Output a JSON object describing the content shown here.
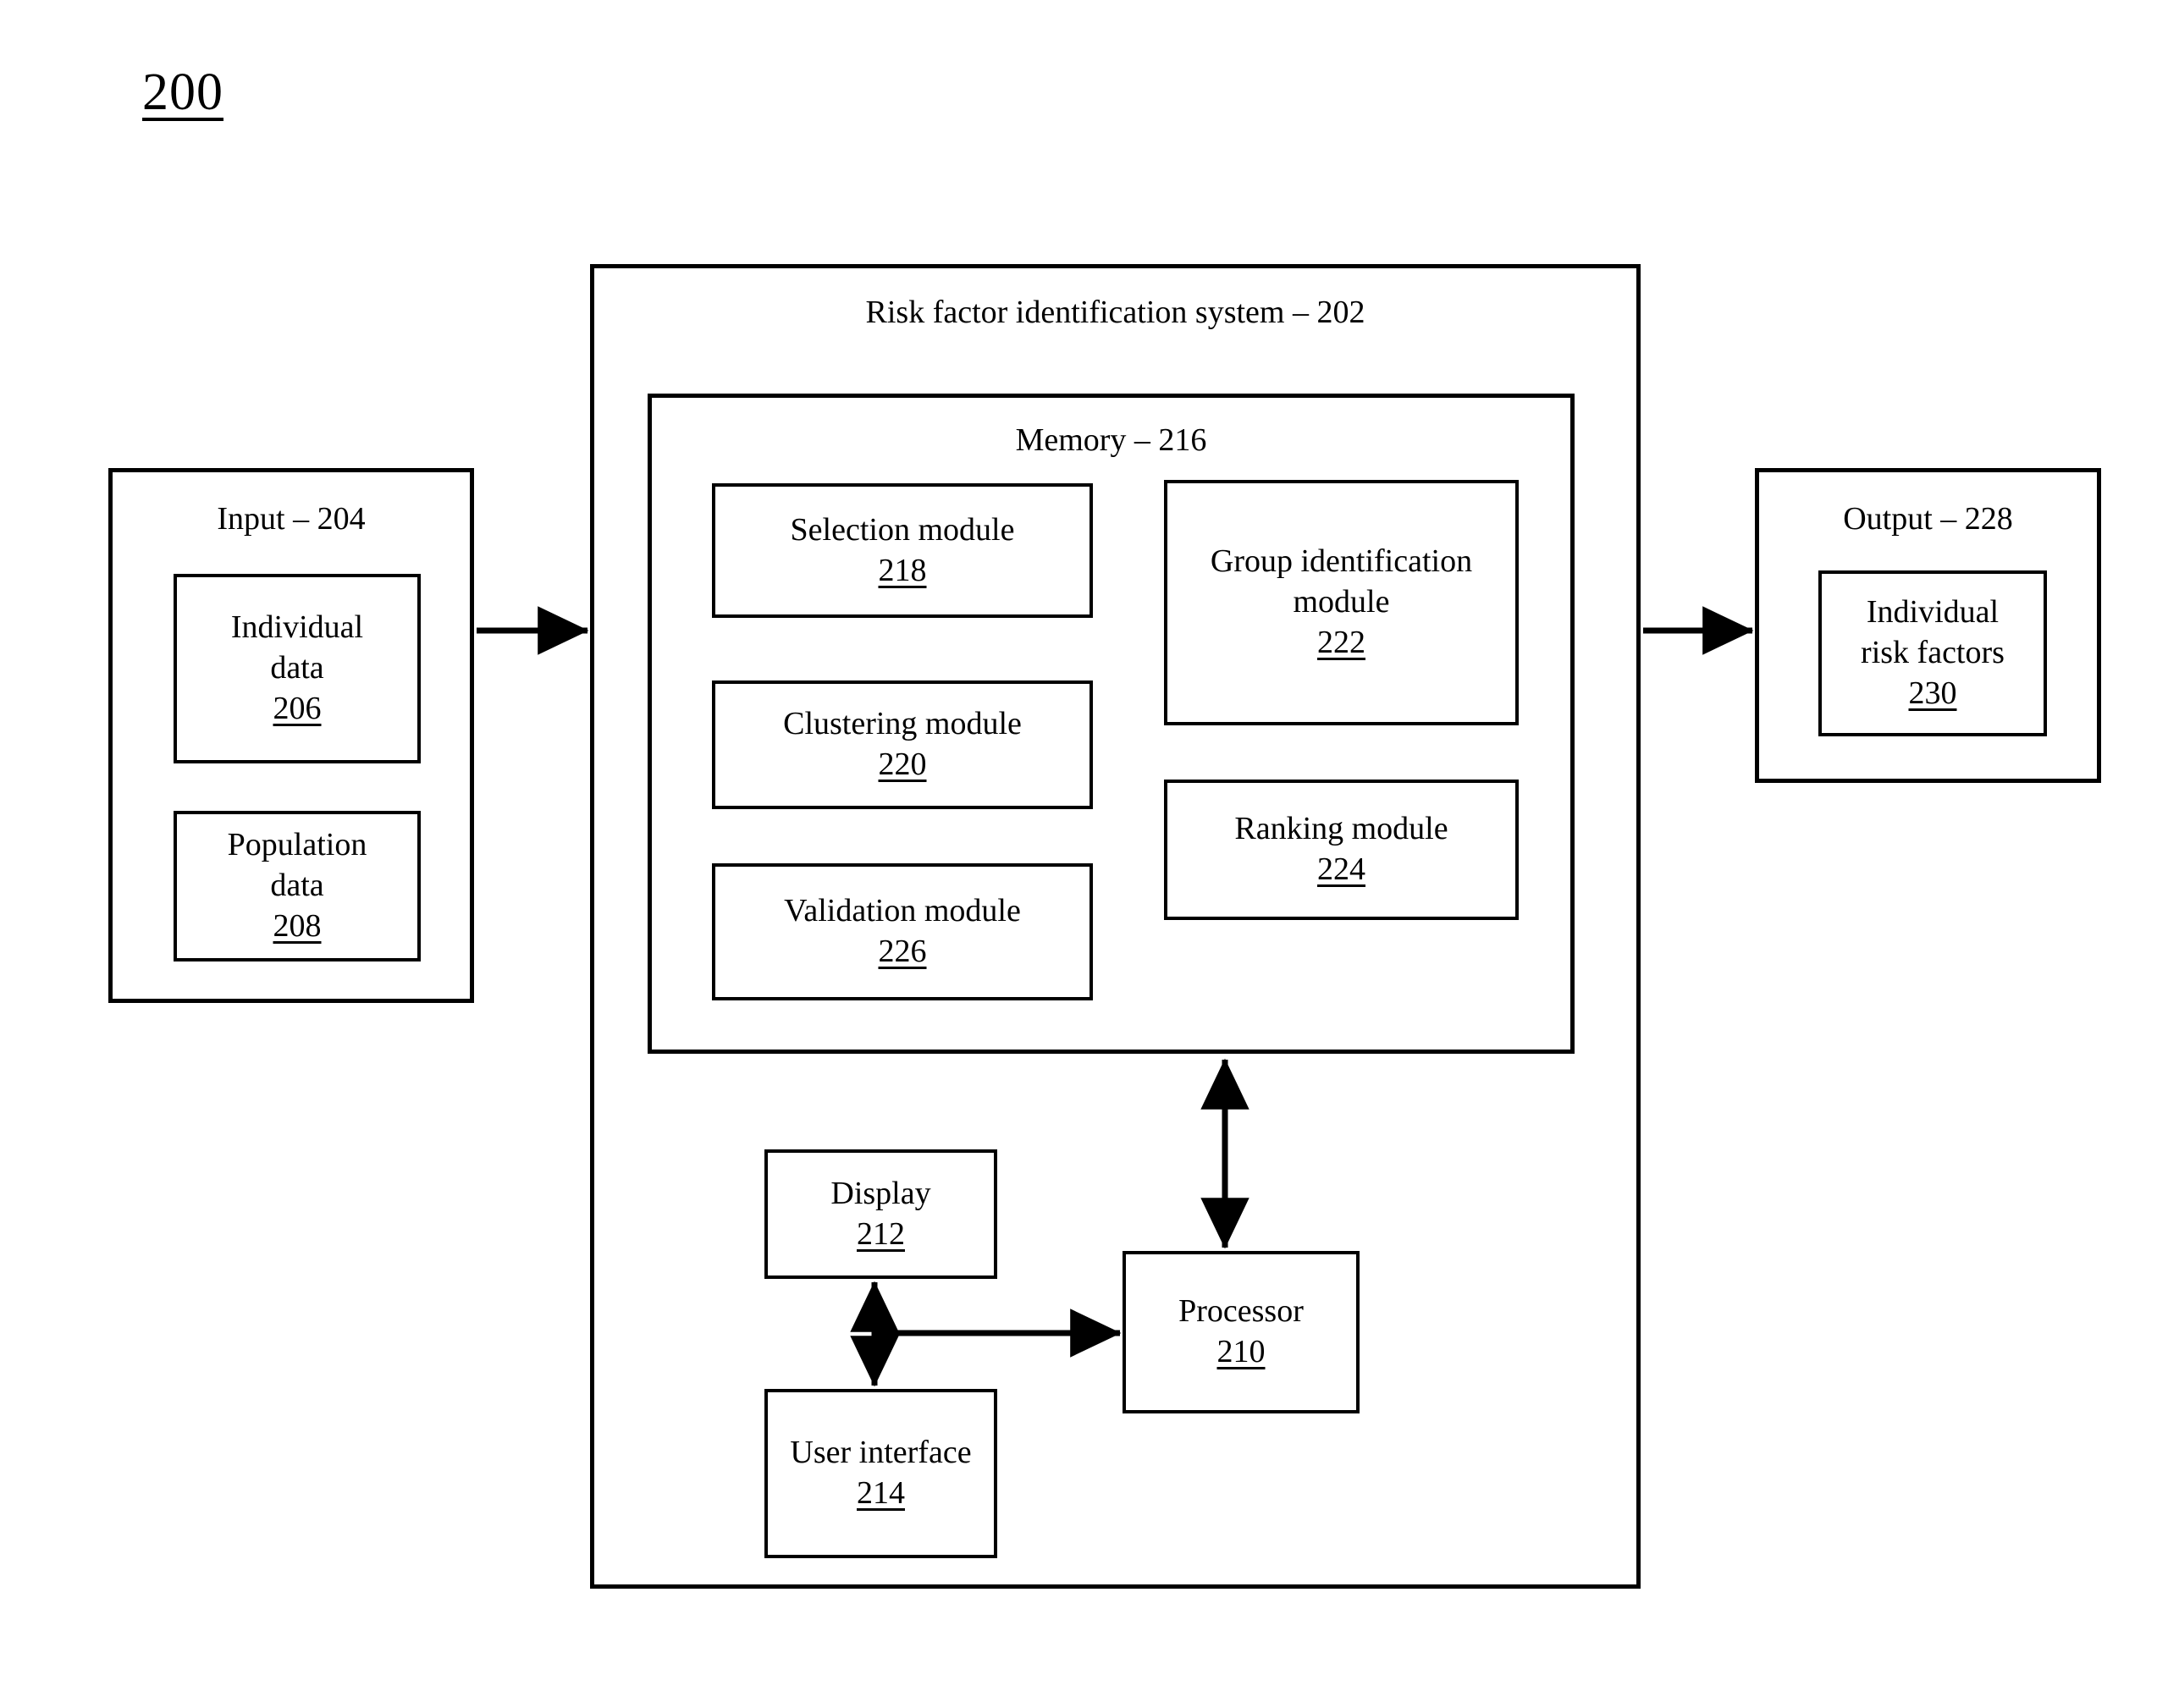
{
  "figure": {
    "number": "200"
  },
  "input_block": {
    "title": "Input – 204",
    "items": [
      {
        "label_line1": "Individual",
        "label_line2": "data",
        "ref": "206"
      },
      {
        "label_line1": "Population",
        "label_line2": "data",
        "ref": "208"
      }
    ]
  },
  "system_block": {
    "title": "Risk factor identification system – 202",
    "memory": {
      "title": "Memory – 216",
      "modules": [
        {
          "name": "Selection module",
          "ref": "218"
        },
        {
          "name": "Clustering module",
          "ref": "220"
        },
        {
          "name": "Validation module",
          "ref": "226"
        },
        {
          "name": "Group identification module",
          "ref": "222"
        },
        {
          "name": "Ranking module",
          "ref": "224"
        }
      ]
    },
    "display": {
      "name": "Display",
      "ref": "212"
    },
    "user_interface": {
      "name": "User interface",
      "ref": "214"
    },
    "processor": {
      "name": "Processor",
      "ref": "210"
    }
  },
  "output_block": {
    "title": "Output – 228",
    "items": [
      {
        "label_line1": "Individual",
        "label_line2": "risk factors",
        "ref": "230"
      }
    ]
  },
  "colors": {
    "stroke": "#000000",
    "background": "#ffffff"
  }
}
